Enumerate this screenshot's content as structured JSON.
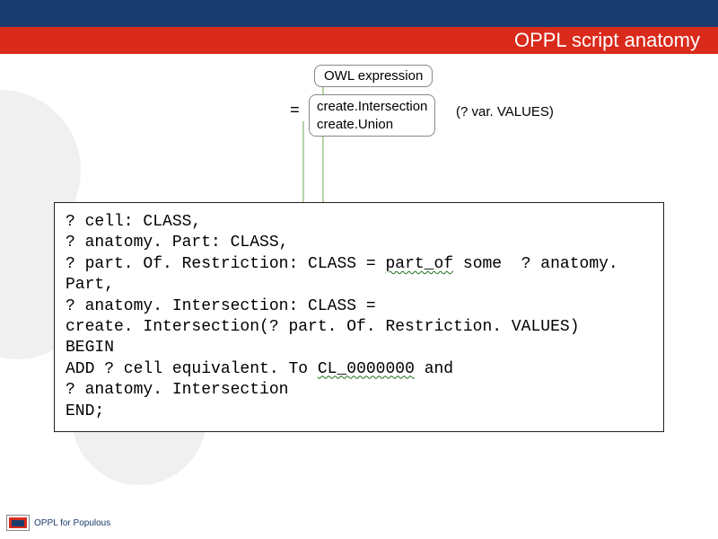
{
  "header": {
    "title": "OPPL script anatomy"
  },
  "annotations": {
    "owl_label": "OWL expression",
    "equals": "=",
    "func1": "create.Intersection",
    "func2": "create.Union",
    "var_values": "(? var. VALUES)"
  },
  "code": {
    "l1": "? cell: CLASS,",
    "l2": "? anatomy. Part: CLASS,",
    "l3a": "? part. Of. Restriction: CLASS = ",
    "l3b": "part_of",
    "l3c": " some  ? anatomy. Part,",
    "l4": "? anatomy. Intersection: CLASS =",
    "l5": "create. Intersection(? part. Of. Restriction. VALUES)",
    "l6": "BEGIN",
    "l7a": "ADD ? cell equivalent. To ",
    "l7b": "CL_0000000",
    "l7c": " and",
    "l8": "? anatomy. Intersection",
    "l9": "END;"
  },
  "footer": {
    "text": "OPPL for Populous"
  }
}
